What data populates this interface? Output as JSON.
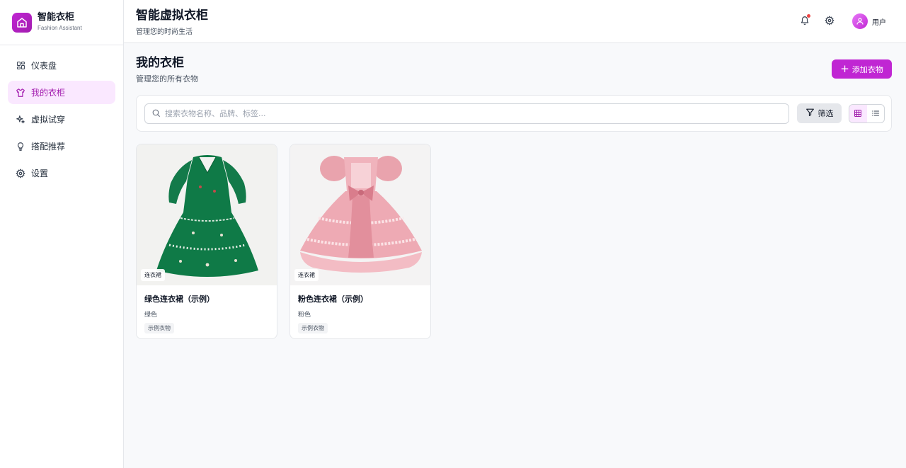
{
  "brand": {
    "title": "智能衣柜",
    "subtitle": "Fashion Assistant"
  },
  "nav": [
    {
      "label": "仪表盘",
      "icon": "dashboard-icon",
      "active": false
    },
    {
      "label": "我的衣柜",
      "icon": "shirt-icon",
      "active": true
    },
    {
      "label": "虚拟试穿",
      "icon": "sparkles-icon",
      "active": false
    },
    {
      "label": "搭配推荐",
      "icon": "lightbulb-icon",
      "active": false
    },
    {
      "label": "设置",
      "icon": "gear-icon",
      "active": false
    }
  ],
  "header": {
    "title": "智能虚拟衣柜",
    "subtitle": "管理您的时尚生活",
    "user_label": "用户"
  },
  "page": {
    "title": "我的衣柜",
    "subtitle": "管理您的所有衣物",
    "add_label": "添加衣物"
  },
  "search": {
    "placeholder": "搜索衣物名称、品牌、标签..."
  },
  "filter": {
    "label": "筛选"
  },
  "colors": {
    "accent": "#c026d3",
    "accent_bg": "#fae8ff",
    "notify": "#ef4444"
  },
  "items": [
    {
      "category": "连衣裙",
      "name": "绿色连衣裙（示例）",
      "color": "绿色",
      "tag": "示例衣物"
    },
    {
      "category": "连衣裙",
      "name": "粉色连衣裙（示例）",
      "color": "粉色",
      "tag": "示例衣物"
    }
  ]
}
